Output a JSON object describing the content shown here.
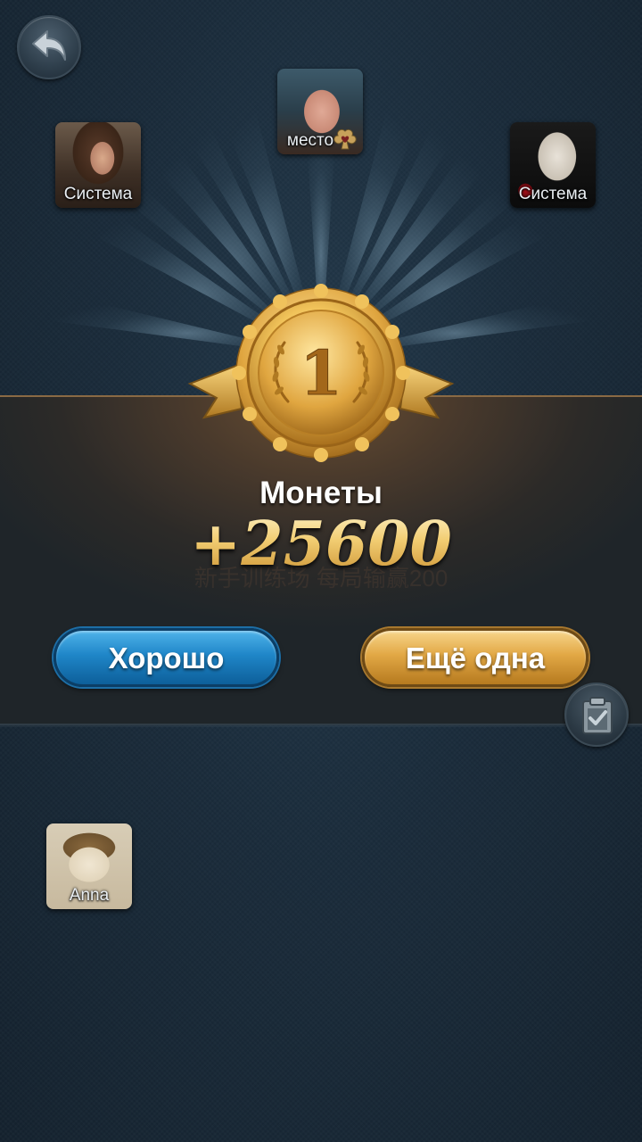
{
  "players": {
    "top": {
      "name": "место"
    },
    "left": {
      "name": "Система"
    },
    "right": {
      "name": "Система"
    },
    "bottom": {
      "name": "Anna"
    }
  },
  "result": {
    "place": "1",
    "reward_title": "Монеты",
    "reward_amount": "+25600",
    "watermark": "新手训练场 每局输赢200"
  },
  "buttons": {
    "ok_label": "Хорошо",
    "again_label": "Ещё одна"
  },
  "colors": {
    "ok_button": "#1f86c8",
    "again_button": "#e2a845",
    "medal_gold": "#f1c35a",
    "background": "#1a2c3b"
  },
  "icons": {
    "back": "back-arrow-icon",
    "suit": "heart-club-icon",
    "clipboard": "clipboard-check-icon",
    "medal": "gold-medal-icon"
  }
}
